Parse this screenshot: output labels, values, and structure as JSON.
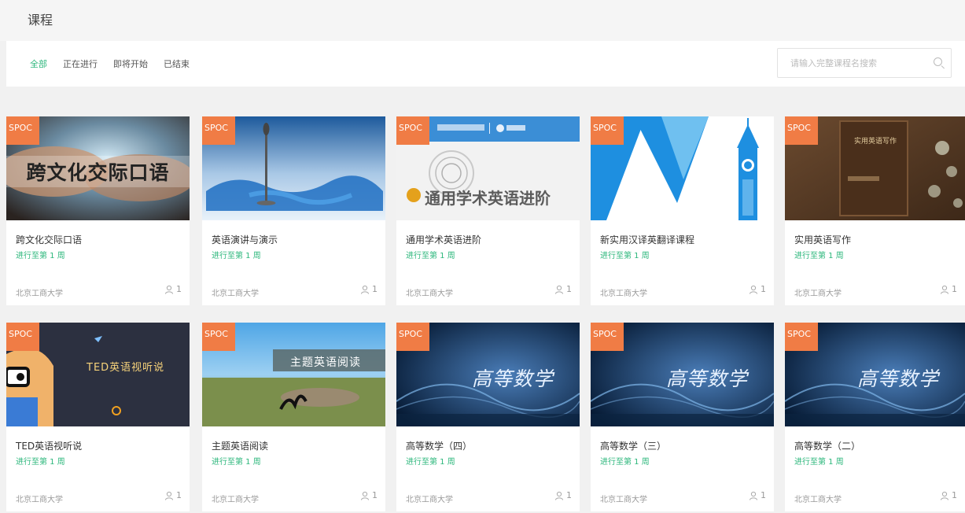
{
  "page": {
    "title": "课程"
  },
  "filters": {
    "tabs": [
      {
        "label": "全部",
        "active": true
      },
      {
        "label": "正在进行",
        "active": false
      },
      {
        "label": "即将开始",
        "active": false
      },
      {
        "label": "已结束",
        "active": false
      }
    ],
    "search_placeholder": "请输入完整课程名搜索",
    "search_icon": "search-icon"
  },
  "badge_label": "SPOC",
  "colors": {
    "accent_green": "#2db77c",
    "badge_orange": "#f07c45"
  },
  "courses": [
    {
      "name": "跨文化交际口语",
      "progress": "进行至第 1 周",
      "school": "北京工商大学",
      "students": "1",
      "cover_text": "跨文化交际口语"
    },
    {
      "name": "英语演讲与演示",
      "progress": "进行至第 1 周",
      "school": "北京工商大学",
      "students": "1",
      "cover_text": ""
    },
    {
      "name": "通用学术英语进阶",
      "progress": "进行至第 1 周",
      "school": "北京工商大学",
      "students": "1",
      "cover_text": "通用学术英语进阶"
    },
    {
      "name": "新实用汉译英翻译课程",
      "progress": "进行至第 1 周",
      "school": "北京工商大学",
      "students": "1",
      "cover_text": ""
    },
    {
      "name": "实用英语写作",
      "progress": "进行至第 1 周",
      "school": "北京工商大学",
      "students": "1",
      "cover_text": "实用英语写作"
    },
    {
      "name": "TED英语视听说",
      "progress": "进行至第 1 周",
      "school": "北京工商大学",
      "students": "1",
      "cover_text": "TED英语视听说"
    },
    {
      "name": "主题英语阅读",
      "progress": "进行至第 1 周",
      "school": "北京工商大学",
      "students": "1",
      "cover_text": "主题英语阅读"
    },
    {
      "name": "高等数学（四）",
      "progress": "进行至第 1 周",
      "school": "北京工商大学",
      "students": "1",
      "cover_text": "高等数学"
    },
    {
      "name": "高等数学（三）",
      "progress": "进行至第 1 周",
      "school": "北京工商大学",
      "students": "1",
      "cover_text": "高等数学"
    },
    {
      "name": "高等数学（二）",
      "progress": "进行至第 1 周",
      "school": "北京工商大学",
      "students": "1",
      "cover_text": "高等数学"
    }
  ]
}
